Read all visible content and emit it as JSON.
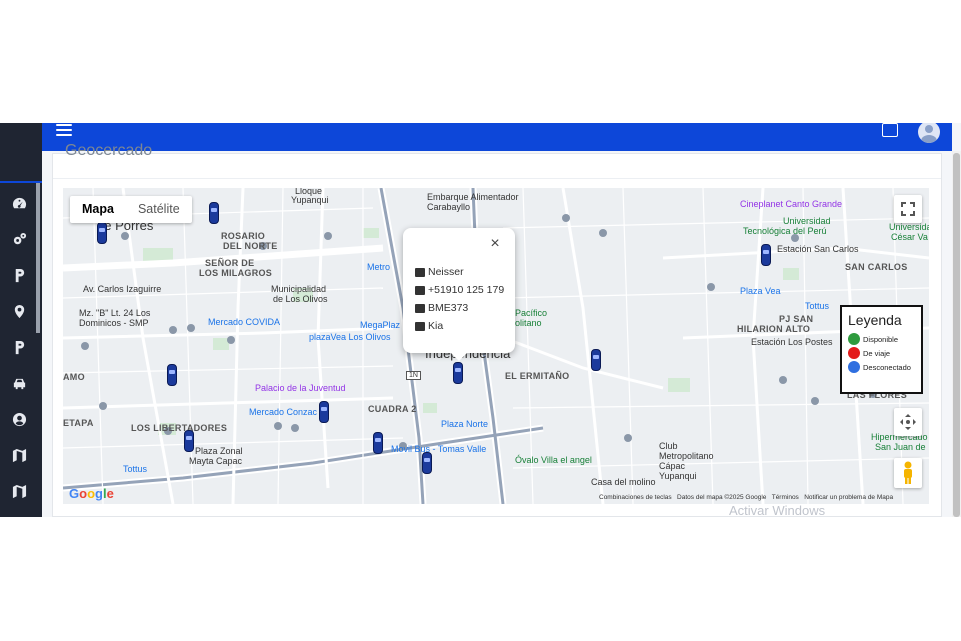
{
  "header": {
    "menu_icon": "hamburger-icon",
    "translate_icon": "translate-icon",
    "user_icon": "user-avatar-icon"
  },
  "sidebar": {
    "items": [
      {
        "icon": "dashboard-icon"
      },
      {
        "icon": "gears-icon"
      },
      {
        "icon": "route-icon"
      },
      {
        "icon": "location-pin-icon"
      },
      {
        "icon": "route-icon"
      },
      {
        "icon": "car-icon"
      },
      {
        "icon": "user-circle-icon"
      },
      {
        "icon": "map-icon"
      },
      {
        "icon": "map-icon"
      }
    ]
  },
  "page": {
    "title": "Geocercado"
  },
  "map": {
    "type_buttons": {
      "map": "Mapa",
      "satellite": "Satélite"
    },
    "popup": {
      "close": "×",
      "driver": "Neisser",
      "phone": "+51910 125 179",
      "plate": "BME373",
      "brand": "Kia"
    },
    "legend": {
      "title": "Leyenda",
      "items": [
        {
          "label": "Disponible",
          "color": "#2e9b3e"
        },
        {
          "label": "De viaje",
          "color": "#e31b1b"
        },
        {
          "label": "Desconectado",
          "color": "#2f6fe0"
        }
      ]
    },
    "places": {
      "lloque": "Lloque",
      "yupanqui": "Yupanqui",
      "embarque": "Embarque Alimentador",
      "carabayllo": "Carabayllo",
      "cineplanet": "Cineplanet Canto Grande",
      "universidad": "Universidad",
      "tecnologica": "Tecnológica del Perú",
      "ucv": "Universidad",
      "cesar": "César Va",
      "porres": "de Porres",
      "rosario": "ROSARIO",
      "del_norte": "DEL NORTE",
      "senor": "SEÑOR DE",
      "milagros": "LOS MILAGROS",
      "metro": "Metro",
      "estacion_sc": "Estación San Carlos",
      "san_carlos": "SAN CARLOS",
      "av_izaguirre": "Av. Carlos Izaguirre",
      "municipalidad": "Municipalidad",
      "de_los_olivos": "de Los Olivos",
      "plaza_vea": "Plaza Vea",
      "tottus": "Tottus",
      "mz_b": "Mz. \"B\" Lt. 24 Los",
      "dominicos": "Dominicos - SMP",
      "mercado_covida": "Mercado COVIDA",
      "megaplaza": "MegaPlaz",
      "plazavea_olivos": "plazaVea Los Olivos",
      "pacifico": "Pacífico",
      "politano": "olitano",
      "pj_san": "PJ SAN",
      "hilarion": "HILARION ALTO",
      "estacion_los_postes": "Estación Los Postes",
      "independencia": "Independencia",
      "el_ermitano": "EL ERMITAÑO",
      "amo": "AMO",
      "palacio": "Palacio de la Juventud",
      "mercado_conzac": "Mercado Conzac",
      "cuadra2": "CUADRA 2",
      "plaza_norte": "Plaza Norte",
      "los_libertadores": "LOS LIBERTADORES",
      "etapa": "ETAPA",
      "las_flores": "LAS FLORES",
      "hipermercado": "Hipermercado",
      "san_juan": "San Juan de",
      "plaza_zonal": "Plaza Zonal",
      "mayta_capac": "Mayta Capac",
      "movil_bus": "Movil Bus - Tomas Valle",
      "ovalo": "Óvalo Villa el angel",
      "club": "Club",
      "metropolitano": "Metropolitano",
      "capac": "Cápac",
      "yupanqui2": "Yupanqui",
      "casa_molino": "Casa del molino",
      "tottus2": "Tottus",
      "road_1n": "1N"
    },
    "attribution": {
      "keys": "Combinaciones de teclas",
      "data": "Datos del mapa ©2025 Google",
      "terms": "Términos",
      "report": "Notificar un problema de Mapa"
    },
    "google": "Google"
  },
  "watermark": "Activar Windows"
}
